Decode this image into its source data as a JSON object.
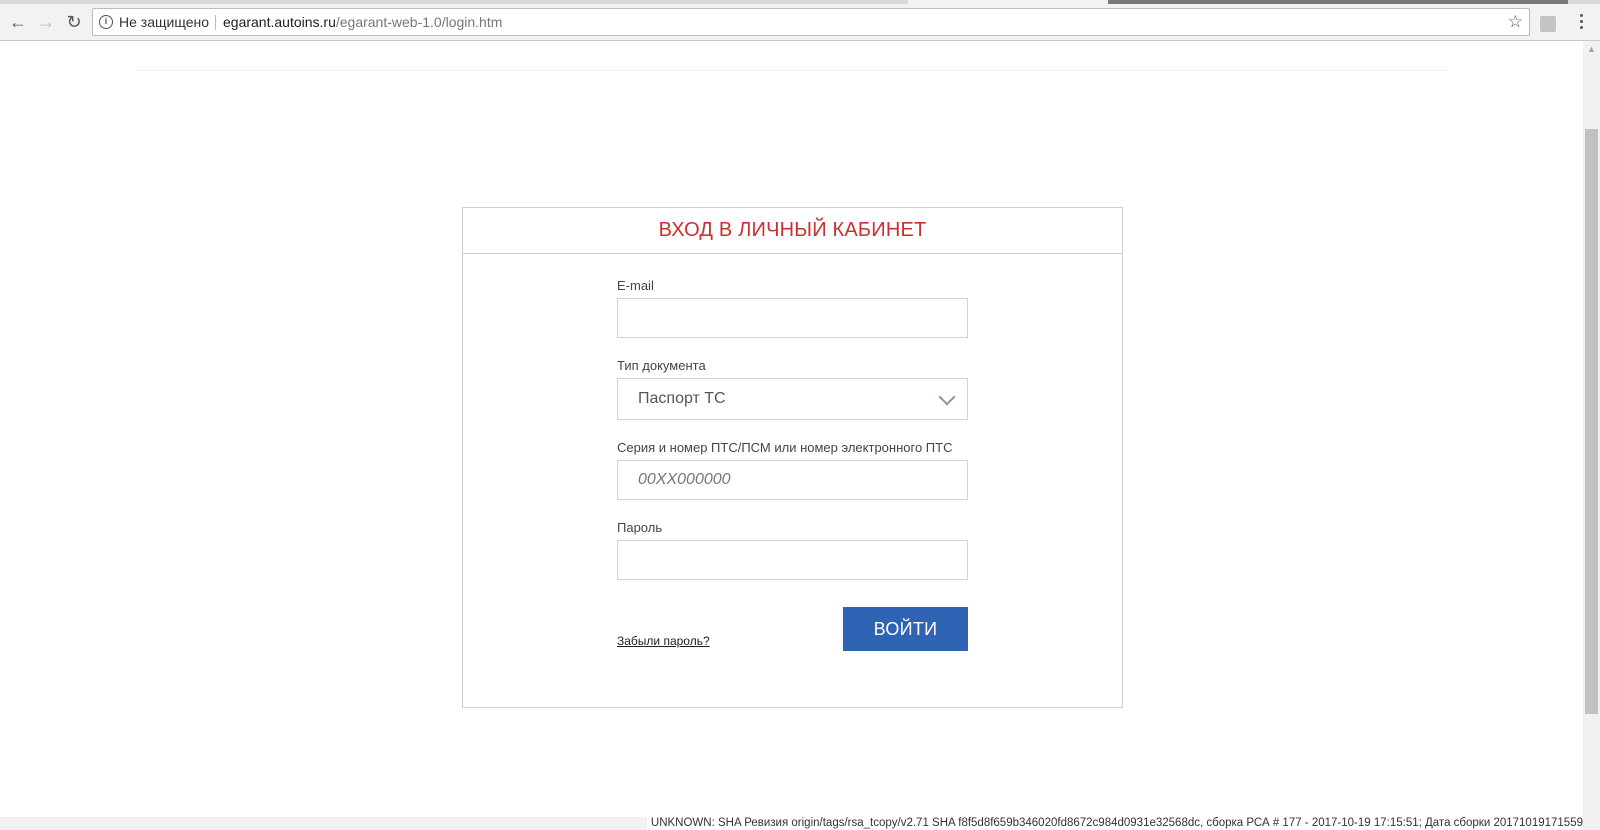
{
  "browser": {
    "security_label": "Не защищено",
    "url_host": "egarant.autoins.ru",
    "url_path": "/egarant-web-1.0/login.htm"
  },
  "login": {
    "title": "ВХОД В ЛИЧНЫЙ КАБИНЕТ",
    "email_label": "E-mail",
    "email_value": "",
    "doctype_label": "Тип документа",
    "doctype_value": "Паспорт ТС",
    "docnum_label": "Серия и номер ПТС/ПСМ или номер электронного ПТС",
    "docnum_placeholder": "00XX000000",
    "password_label": "Пароль",
    "password_value": "",
    "forgot_label": "Забыли пароль?",
    "submit_label": "ВОЙТИ"
  },
  "footer": {
    "build_info": "UNKNOWN: SHA Ревизия origin/tags/rsa_tcopy/v2.71 SHA f8f5d8f659b346020fd8672c984d0931e32568dc, сборка РСА # 177 - 2017-10-19 17:15:51; Дата сборки 20171019171559"
  },
  "colors": {
    "title_red": "#c8312f",
    "button_blue": "#2f64b4"
  }
}
